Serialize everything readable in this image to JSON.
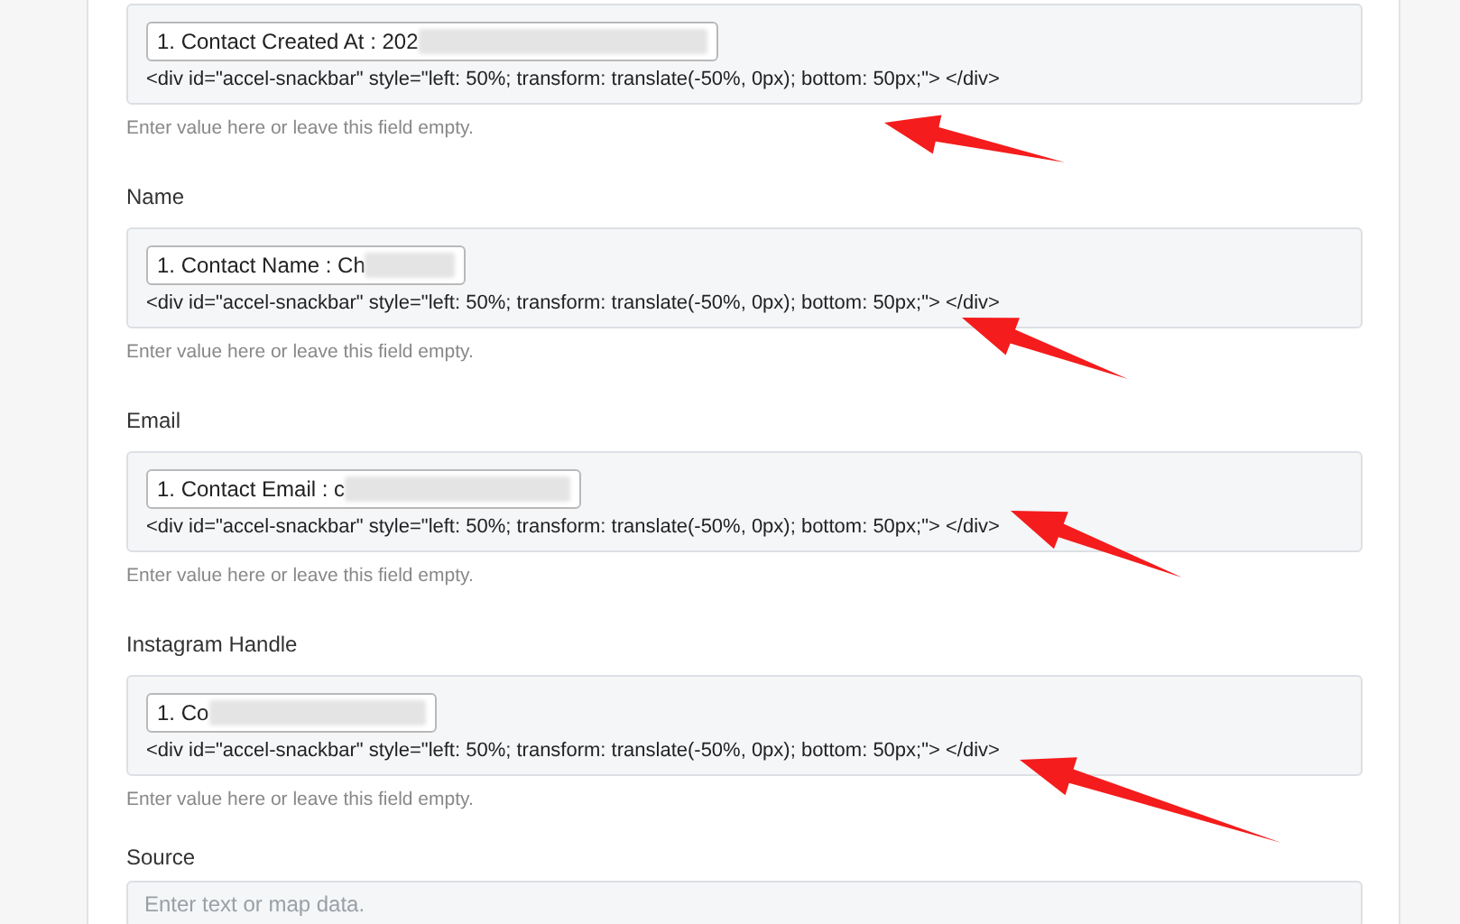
{
  "fields": [
    {
      "chip": "1. Contact Created At : 202",
      "code": "<div id=\"accel-snackbar\" style=\"left: 50%; transform: translate(-50%, 0px); bottom: 50px;\"> </div>",
      "hint": "Enter value here or leave this field empty."
    },
    {
      "label": "Name",
      "chip": "1. Contact Name : Ch",
      "code": "<div id=\"accel-snackbar\" style=\"left: 50%; transform: translate(-50%, 0px); bottom: 50px;\"> </div>",
      "hint": "Enter value here or leave this field empty."
    },
    {
      "label": "Email",
      "chip": "1. Contact Email : c",
      "code": "<div id=\"accel-snackbar\" style=\"left: 50%; transform: translate(-50%, 0px); bottom: 50px;\"> </div>",
      "hint": "Enter value here or leave this field empty."
    },
    {
      "label": "Instagram Handle",
      "chip": "1. Co",
      "code": "<div id=\"accel-snackbar\" style=\"left: 50%; transform: translate(-50%, 0px); bottom: 50px;\"> </div>",
      "hint": "Enter value here or leave this field empty."
    }
  ],
  "source": {
    "label": "Source",
    "placeholder": "Enter text or map data."
  }
}
